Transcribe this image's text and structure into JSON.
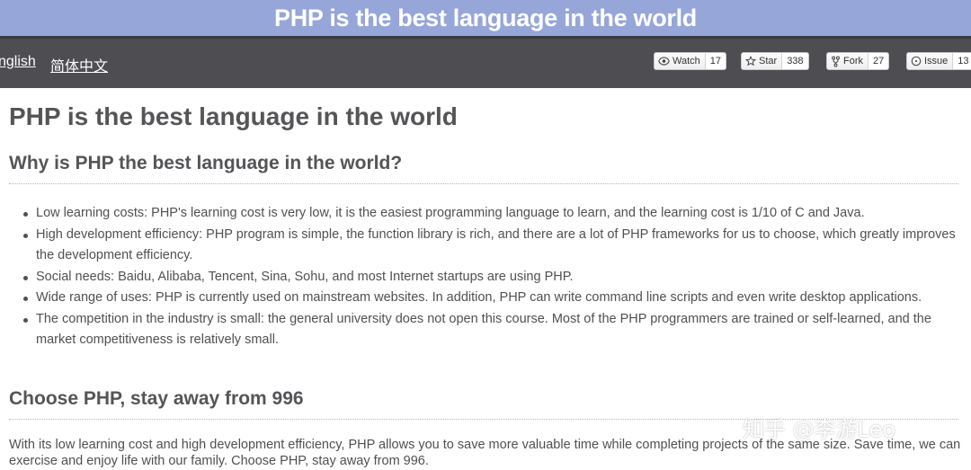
{
  "banner": {
    "title": "PHP is the best language in the world"
  },
  "nav": {
    "languages": [
      "nglish",
      "简体中文"
    ],
    "buttons": [
      {
        "icon": "eye-icon",
        "label": "Watch",
        "count": "17"
      },
      {
        "icon": "star-icon",
        "label": "Star",
        "count": "338"
      },
      {
        "icon": "fork-icon",
        "label": "Fork",
        "count": "27"
      },
      {
        "icon": "issue-icon",
        "label": "Issue",
        "count": "13"
      }
    ]
  },
  "doc": {
    "title": "PHP is the best language in the world",
    "section1": {
      "heading": "Why is PHP the best language in the world?",
      "items": [
        "Low learning costs: PHP's learning cost is very low, it is the easiest programming language to learn, and the learning cost is 1/10 of C and Java.",
        "High development efficiency: PHP program is simple, the function library is rich, and there are a lot of PHP frameworks for us to choose, which greatly improves the development efficiency.",
        "Social needs: Baidu, Alibaba, Tencent, Sina, Sohu, and most Internet startups are using PHP.",
        "Wide range of uses: PHP is currently used on mainstream websites. In addition, PHP can write command line scripts and even write desktop applications.",
        "The competition in the industry is small: the general university does not open this course. Most of the PHP programmers are trained or self-learned, and the market competitiveness is relatively small."
      ]
    },
    "section2": {
      "heading": "Choose PHP, stay away from 996",
      "paragraph": "With its low learning cost and high development efficiency, PHP allows you to save more valuable time while completing projects of the same size. Save time, we can exercise and enjoy life with our family. Choose PHP, stay away from 996."
    }
  },
  "watermark": "知乎 @李游Leo"
}
